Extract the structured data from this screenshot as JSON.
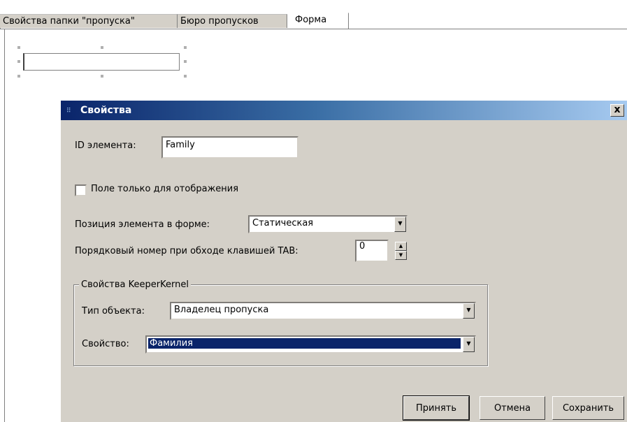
{
  "tabs": [
    {
      "label": "Свойства папки \"пропуска\""
    },
    {
      "label": "Бюро пропусков"
    },
    {
      "label": "Форма"
    }
  ],
  "dialog": {
    "title": "Свойства",
    "close_label": "x",
    "element_id_label": "ID элемента:",
    "element_id_value": "Family",
    "display_only_label": "Поле только для отображения",
    "display_only_checked": false,
    "position_label": "Позиция элемента в форме:",
    "position_value": "Статическая",
    "tab_order_label": "Порядковый номер при обходе клавишей TAB:",
    "tab_order_value": "0",
    "group": {
      "title": "Свойства KeeperKernel",
      "object_type_label": "Тип объекта:",
      "object_type_value": "Владелец пропуска",
      "property_label": "Свойство:",
      "property_value": "Фамилия"
    },
    "buttons": {
      "accept": "Принять",
      "cancel": "Отмена",
      "save": "Сохранить"
    }
  }
}
